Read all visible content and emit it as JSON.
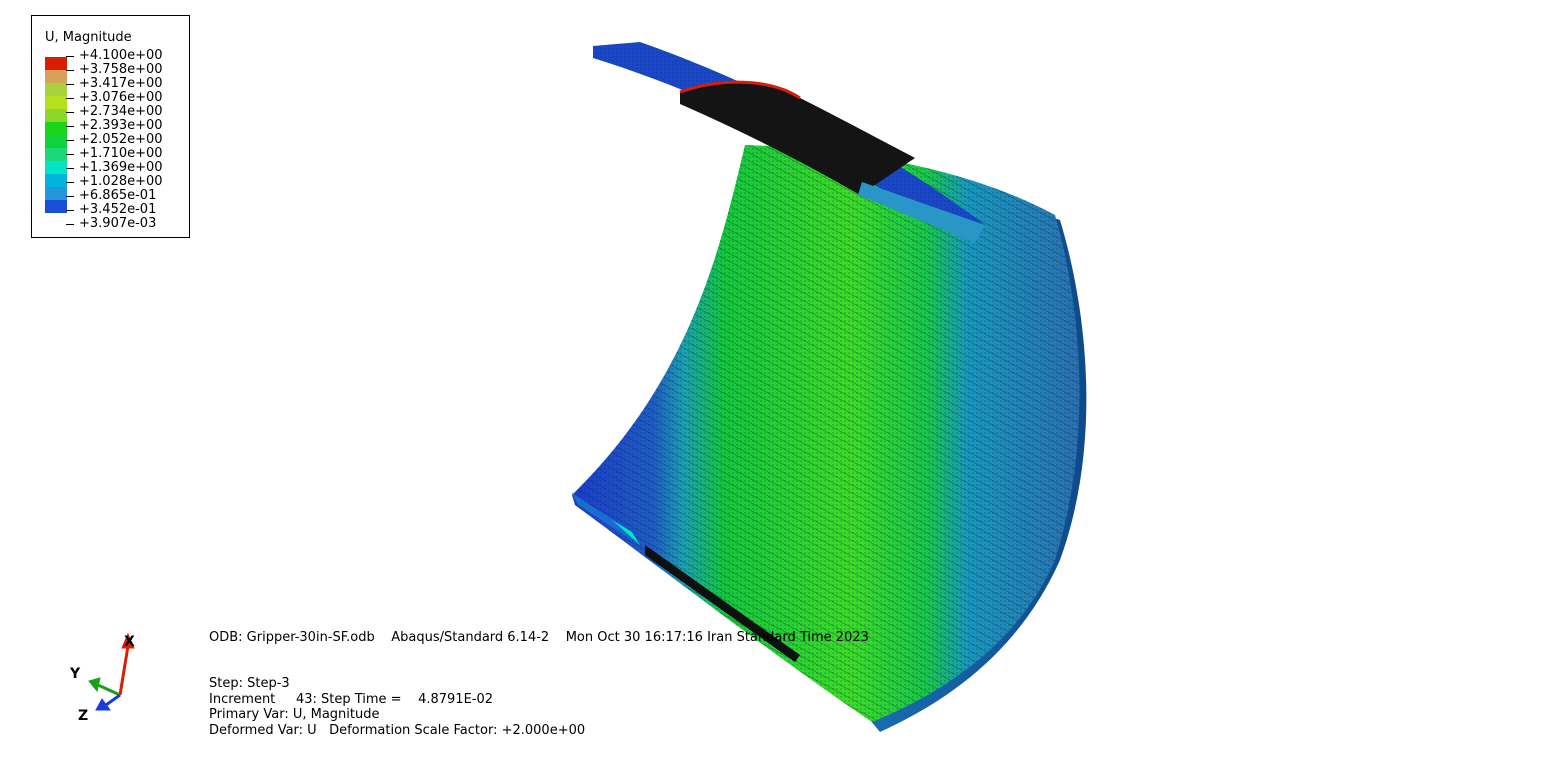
{
  "legend": {
    "title": "U, Magnitude",
    "values": [
      "+4.100e+00",
      "+3.758e+00",
      "+3.417e+00",
      "+3.076e+00",
      "+2.734e+00",
      "+2.393e+00",
      "+2.052e+00",
      "+1.710e+00",
      "+1.369e+00",
      "+1.028e+00",
      "+6.865e-01",
      "+3.452e-01",
      "+3.907e-03"
    ],
    "colors": [
      "#d81e05",
      "#d8a05a",
      "#a8d23c",
      "#b4e01e",
      "#8cd828",
      "#19d619",
      "#0fd23c",
      "#1bd878",
      "#00e4c8",
      "#00b4dc",
      "#2396dc",
      "#1a50d8"
    ]
  },
  "info": {
    "odb_line": "ODB: Gripper-30in-SF.odb    Abaqus/Standard 6.14-2    Mon Oct 30 16:17:16 Iran Standard Time 2023",
    "step": "Step: Step-3",
    "increment": "Increment     43: Step Time =    4.8791E-02",
    "primary_var": "Primary Var: U, Magnitude",
    "deformed_var": "Deformed Var: U   Deformation Scale Factor: +2.000e+00"
  },
  "triad": {
    "x_label": "X",
    "y_label": "Y",
    "z_label": "Z",
    "x_color": "#d81e05",
    "y_color": "#19a019",
    "z_color": "#1a3cd8"
  },
  "model": {
    "outer_color": "#2a8cc8",
    "mid_color": "#19c819",
    "inner_color": "#1a46d0",
    "pad_color": "#1a1a1a",
    "hot_color": "#d81e05"
  }
}
